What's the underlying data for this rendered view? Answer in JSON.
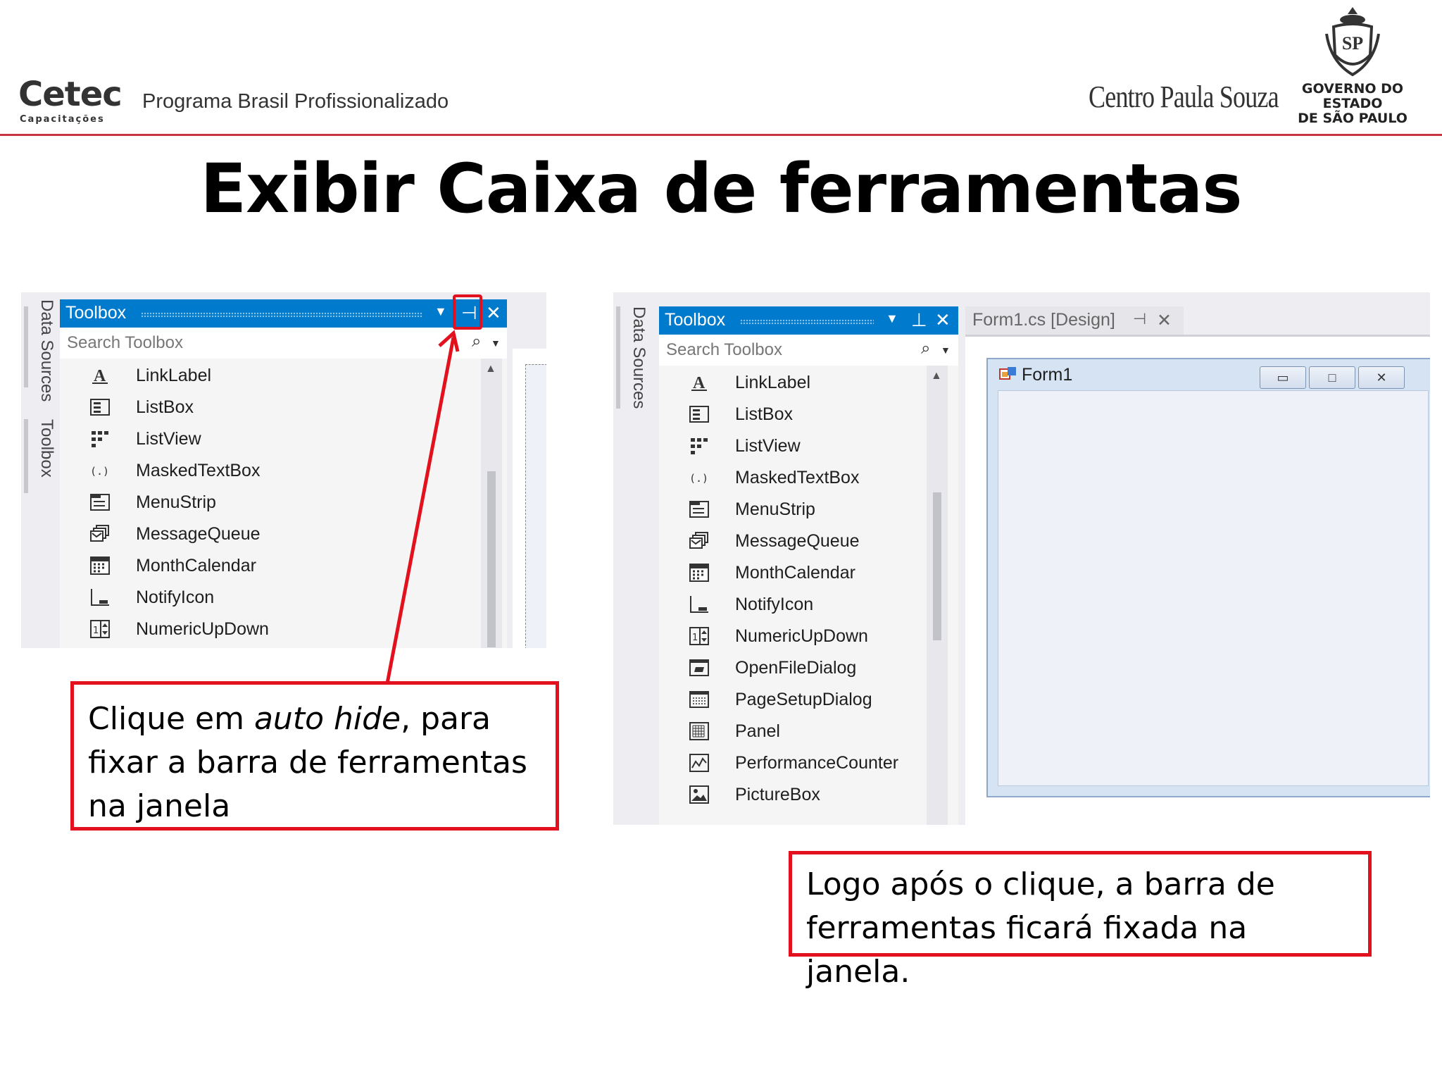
{
  "header": {
    "brand": "Cetec",
    "brand_sub": "Capacitações",
    "program": "Programa Brasil Profissionalizado",
    "partner": "Centro Paula Souza",
    "government_line1": "GOVERNO DO ESTADO",
    "government_line2": "DE SÃO PAULO",
    "seal_text": "SP"
  },
  "title": "Exibir Caixa de ferramentas",
  "left_shot": {
    "side_tabs": [
      "Data Sources",
      "Toolbox"
    ],
    "toolbox_title": "Toolbox",
    "search_placeholder": "Search Toolbox",
    "items": [
      "LinkLabel",
      "ListBox",
      "ListView",
      "MaskedTextBox",
      "MenuStrip",
      "MessageQueue",
      "MonthCalendar",
      "NotifyIcon",
      "NumericUpDown"
    ]
  },
  "right_shot": {
    "side_tabs": [
      "Data Sources"
    ],
    "toolbox_title": "Toolbox",
    "search_placeholder": "Search Toolbox",
    "document_tab": "Form1.cs [Design]",
    "form_title": "Form1",
    "items": [
      "LinkLabel",
      "ListBox",
      "ListView",
      "MaskedTextBox",
      "MenuStrip",
      "MessageQueue",
      "MonthCalendar",
      "NotifyIcon",
      "NumericUpDown",
      "OpenFileDialog",
      "PageSetupDialog",
      "Panel",
      "PerformanceCounter",
      "PictureBox"
    ]
  },
  "callouts": {
    "left_before": "Clique em ",
    "left_italic": "auto hide",
    "left_after": ", para fixar a barra de ferramentas na janela",
    "right": "Logo após o clique, a barra de ferramentas ficará fixada na janela."
  },
  "colors": {
    "accent_blue": "#007acc",
    "highlight_red": "#e3111d",
    "header_rule": "#c8343e"
  }
}
